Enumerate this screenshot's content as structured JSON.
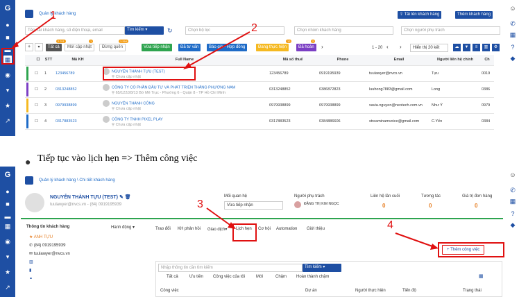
{
  "screen1": {
    "breadcrumb": "Quản lý khách hàng",
    "import_button": "Tải lên khách hàng",
    "add_customer_button": "Thêm khách hàng",
    "search_placeholder": "Tên, tài khách hàng, số điện thoại, email",
    "search_button": "Tìm kiếm",
    "filter_group": "Chọn bộ lọc",
    "filter_customer_group": "Chọn nhóm khách hàng",
    "filter_owner": "Chọn người phụ trách",
    "status_tabs": [
      {
        "label": "Tất cả",
        "badge": "2.211"
      },
      {
        "label": "Mới cập nhật",
        "badge": "1"
      },
      {
        "label": "Đừng quên",
        "badge": "1.264"
      },
      {
        "label": "Vừa tiếp nhận",
        "badge": ""
      },
      {
        "label": "Đã tư vấn",
        "badge": ""
      },
      {
        "label": "Báo giá - Hợp đồng",
        "badge": ""
      },
      {
        "label": "Đang thực hiện",
        "badge": "12"
      },
      {
        "label": "Đã hoàn",
        "badge": "2"
      }
    ],
    "pagination": "1 - 20",
    "per_page": "Hiển thị 20 kết",
    "columns": [
      "STT",
      "Mã KH",
      "Full Name",
      "Mã số thuế",
      "Phone",
      "Email",
      "Người liên hệ chính",
      "Ch"
    ],
    "rows": [
      {
        "stt": "1",
        "code": "123456789",
        "name": "NGUYỄN THÀNH TỰU (TEST)",
        "addr": "Chưa cập nhật",
        "tax": "123456789",
        "phone": "0919195939",
        "email": "tuulawyer@nvcs.vn",
        "contact": "Tựu",
        "extra": "0019"
      },
      {
        "stt": "2",
        "code": "0313248852",
        "name": "CÔNG TY CỔ PHẦN ĐẦU TƯ VÀ PHÁT TRIỂN THĂNG PHƯƠNG NAM",
        "addr": "65/122/28/13 Bờ Mê Trục - Phường 6 - Quận 8 - TP Hồ Chí Minh",
        "tax": "0313248852",
        "phone": "0386872823",
        "email": "luuhong7883@gmail.com",
        "contact": "Long",
        "extra": "0386"
      },
      {
        "stt": "3",
        "code": "0979938899",
        "name": "NGUYỄN THÀNH CÔNG",
        "addr": "Chưa cập nhật",
        "tax": "0979938899",
        "phone": "0979938899",
        "email": "xavia.nguyen@neotech.com.vn",
        "contact": "Như Ý",
        "extra": "0979"
      },
      {
        "stt": "4",
        "code": "0317883523",
        "name": "CÔNG TY TNHH PIXEL PLAY",
        "addr": "Chưa cập nhật",
        "tax": "0317883523",
        "phone": "0384886606",
        "email": "streaminamvoice@gmail.com",
        "contact": "C.Yến",
        "extra": "0384"
      }
    ]
  },
  "instruction": "Tiếp tục vào lịch hẹn => Thêm công việc",
  "screen2": {
    "breadcrumb": "Quản lý khách hàng \\ Chi tiết khách hàng",
    "customer_name": "NGUYỄN THÀNH TỰU (TEST)",
    "customer_contact": "tuulawyer@nvcs.vn - (84) 0919195939",
    "relation_label": "Mối quan hệ",
    "relation_value": "Vừa tiếp nhận",
    "owner_label": "Người phụ trách",
    "owner_name": "ĐẶNG THỊ KIM NGỌC",
    "last_contact_label": "Liên hệ lần cuối",
    "last_contact_value": "0",
    "interaction_label": "Tương tác",
    "interaction_value": "0",
    "order_value_label": "Giá trị đơn hàng",
    "order_value": "0",
    "info_title": "Thông tin khách hàng",
    "actions_label": "Hành động",
    "info_name": "ANH TỰU",
    "info_phone": "(84) 0919195939",
    "info_email": "tuulawyer@nvcs.vn",
    "tabs": [
      "Trao đổi",
      "KH phản hồi",
      "Giao dịch",
      "Lịch hẹn",
      "Cơ hội",
      "Automation",
      "Giới thiệu"
    ],
    "add_task_button": "+ Thêm công việc",
    "search_placeholder": "Nhập thông tin cần tìm kiếm",
    "search_button": "Tìm kiếm",
    "filter_tabs": [
      "Tất cả",
      "Ưu tiên",
      "Công việc của tôi",
      "Mới",
      "Chậm",
      "Hoàn thành chậm"
    ],
    "table_columns": [
      "Công việc",
      "Dự án",
      "Người thực hiện",
      "Tiến độ",
      "Trạng thái"
    ]
  },
  "markers": [
    "1",
    "2",
    "3",
    "4"
  ]
}
